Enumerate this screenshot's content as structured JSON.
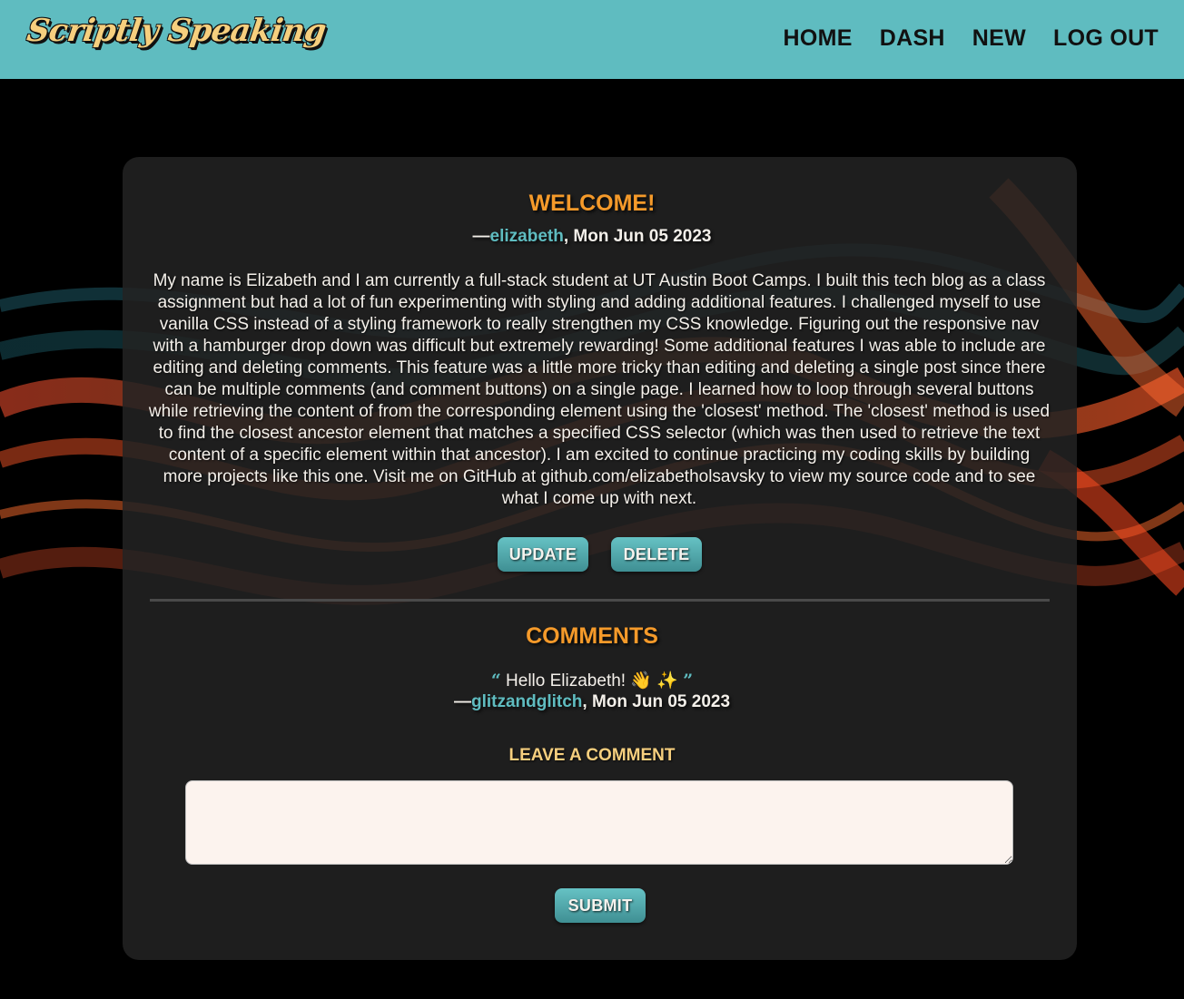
{
  "header": {
    "logo": "Scriptly Speaking",
    "nav": [
      "HOME",
      "DASH",
      "NEW",
      "LOG OUT"
    ]
  },
  "post": {
    "title": "WELCOME!",
    "dash": "—",
    "author": "elizabeth",
    "date_sep": ", ",
    "date": "Mon Jun 05 2023",
    "body": "My name is Elizabeth and I am currently a full-stack student at UT Austin Boot Camps. I built this tech blog as a class assignment but had a lot of fun experimenting with styling and adding additional features. I challenged myself to use vanilla CSS instead of a styling framework to really strengthen my CSS knowledge. Figuring out the responsive nav with a hamburger drop down was difficult but extremely rewarding! Some additional features I was able to include are editing and deleting comments. This feature was a little more tricky than editing and deleting a single post since there can be multiple comments (and comment buttons) on a single page. I learned how to loop through several buttons while retrieving the content of from the corresponding element using the 'closest' method. The 'closest' method is used to find the closest ancestor element that matches a specified CSS selector (which was then used to retrieve the text content of a specific element within that ancestor). I am excited to continue practicing my coding skills by building more projects like this one. Visit me on GitHub at github.com/elizabetholsavsky to view my source code and to see what I come up with next.",
    "update_label": "UPDATE",
    "delete_label": "DELETE"
  },
  "comments": {
    "title": "COMMENTS",
    "open_quote": "“",
    "close_quote": "”",
    "items": [
      {
        "text": "Hello Elizabeth! 👋 ✨",
        "dash": "—",
        "author": "glitzandglitch",
        "date_sep": ", ",
        "date": "Mon Jun 05 2023"
      }
    ],
    "leave_label": "LEAVE A COMMENT",
    "input_value": "",
    "submit_label": "SUBMIT"
  },
  "colors": {
    "header_bg": "#5fbcc0",
    "accent_orange": "#f59a2a",
    "accent_teal": "#5fbcc0",
    "label_gold": "#f6cf7e"
  }
}
